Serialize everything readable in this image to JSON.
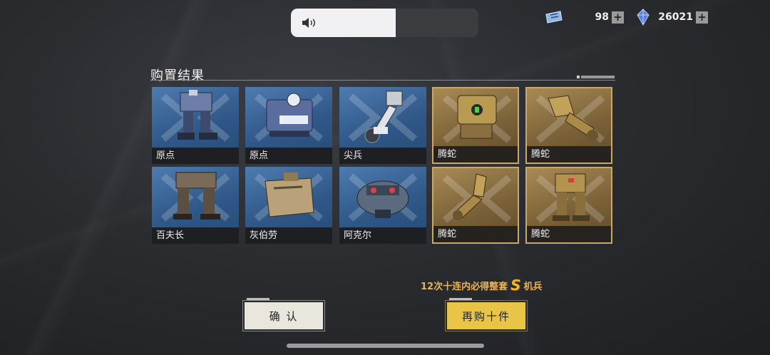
{
  "volume": {
    "icon": "speaker-icon",
    "level": 0.56
  },
  "currency": [
    {
      "icon": "ticket-icon",
      "amount": "98"
    },
    {
      "icon": "crystal-icon",
      "amount": "26021"
    }
  ],
  "title": "购置结果",
  "cards": [
    {
      "name": "原点",
      "rarity": "normal"
    },
    {
      "name": "原点",
      "rarity": "normal"
    },
    {
      "name": "尖兵",
      "rarity": "normal"
    },
    {
      "name": "腾蛇",
      "rarity": "special"
    },
    {
      "name": "腾蛇",
      "rarity": "special"
    },
    {
      "name": "百夫长",
      "rarity": "normal"
    },
    {
      "name": "灰伯劳",
      "rarity": "normal"
    },
    {
      "name": "阿克尔",
      "rarity": "normal"
    },
    {
      "name": "腾蛇",
      "rarity": "special"
    },
    {
      "name": "腾蛇",
      "rarity": "special"
    }
  ],
  "promo": {
    "prefix": "12次十连内必得整套",
    "badge": "S",
    "suffix": "机兵"
  },
  "buttons": {
    "confirm": "确 认",
    "again": "再购十件"
  },
  "colors": {
    "accent_gold": "#e8c447",
    "card_blue": "#2f5787",
    "card_gold": "#7b6238"
  }
}
